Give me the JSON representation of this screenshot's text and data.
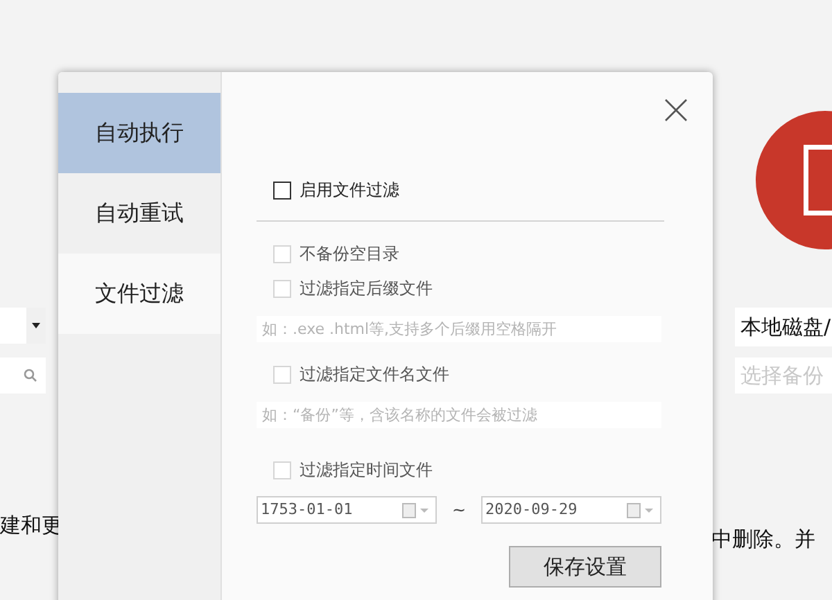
{
  "background": {
    "left": {
      "text": "建和更"
    },
    "right": {
      "path_value": "本地磁盘/",
      "path_placeholder": "选择备份",
      "text": "中删除。并"
    }
  },
  "dialog": {
    "tabs": [
      {
        "label": "自动执行",
        "selected": true
      },
      {
        "label": "自动重试",
        "selected": false
      },
      {
        "label": "文件过滤",
        "selected": false
      }
    ],
    "enable_filter": {
      "label": "启用文件过滤",
      "checked": false
    },
    "options": [
      {
        "kind": "checkbox",
        "label": "不备份空目录",
        "checked": false,
        "disabled": true
      },
      {
        "kind": "checkbox",
        "label": "过滤指定后缀文件",
        "checked": false,
        "disabled": true
      },
      {
        "kind": "input",
        "placeholder": "如：.exe .html等,支持多个后缀用空格隔开",
        "disabled": true
      },
      {
        "kind": "checkbox",
        "label": "过滤指定文件名文件",
        "checked": false,
        "disabled": true
      },
      {
        "kind": "input",
        "placeholder": "如：“备份”等，含该名称的文件会被过滤",
        "disabled": true
      },
      {
        "kind": "checkbox",
        "label": "过滤指定时间文件",
        "checked": false,
        "disabled": true
      }
    ],
    "date_range": {
      "from": "1753-01-01",
      "separator": "~",
      "to": "2020-09-29",
      "disabled": true
    },
    "save_button": "保存设置"
  }
}
